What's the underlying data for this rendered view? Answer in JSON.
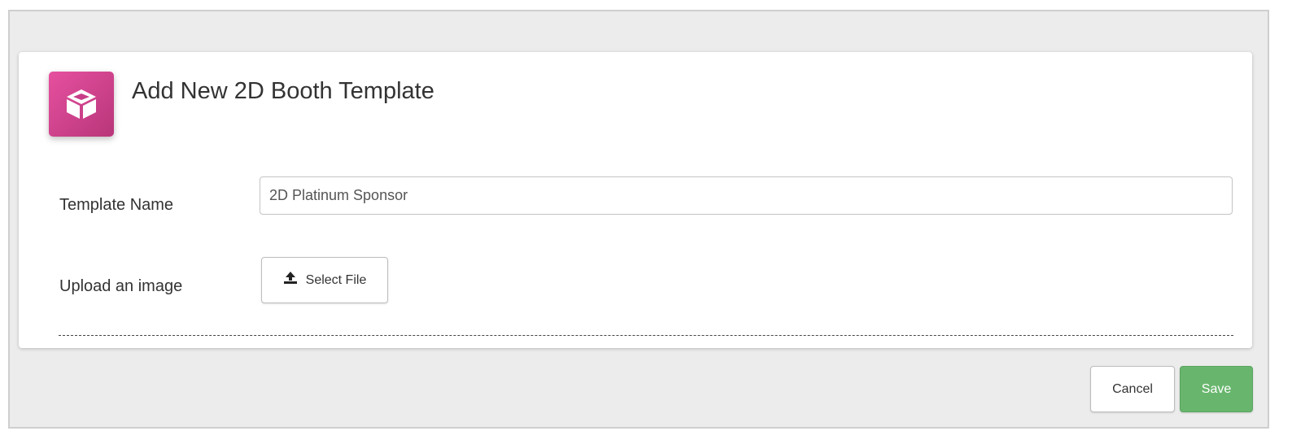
{
  "dialog": {
    "title": "Add New 2D Booth Template",
    "icon": "cube-icon",
    "accent_color": "#d8449a"
  },
  "form": {
    "template_name": {
      "label": "Template Name",
      "value": "2D Platinum Sponsor"
    },
    "upload": {
      "label": "Upload an image",
      "button_label": "Select File",
      "icon": "upload-icon"
    }
  },
  "actions": {
    "cancel_label": "Cancel",
    "save_label": "Save",
    "save_color": "#68b66d"
  }
}
